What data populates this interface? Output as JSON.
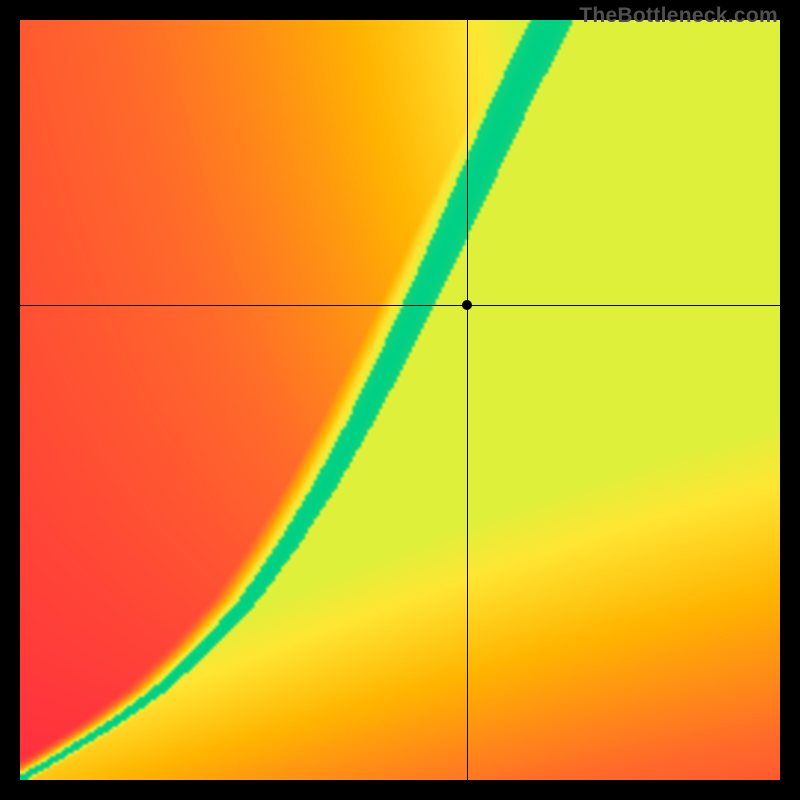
{
  "watermark": "TheBottleneck.com",
  "chart_data": {
    "type": "heatmap",
    "title": "",
    "xlabel": "",
    "ylabel": "",
    "xlim": [
      0,
      1
    ],
    "ylim": [
      0,
      1
    ],
    "grid": false,
    "legend": "none",
    "field_description": "value = closeness to ideal ridge; 1.0 on ridge (green), 0.0 far (red); asymmetric falloff with warmer plateau to the right of ridge",
    "ridge_curve_samples": [
      {
        "x": 0.0,
        "y": 0.0
      },
      {
        "x": 0.06,
        "y": 0.035
      },
      {
        "x": 0.12,
        "y": 0.072
      },
      {
        "x": 0.18,
        "y": 0.115
      },
      {
        "x": 0.24,
        "y": 0.17
      },
      {
        "x": 0.3,
        "y": 0.235
      },
      {
        "x": 0.35,
        "y": 0.305
      },
      {
        "x": 0.4,
        "y": 0.385
      },
      {
        "x": 0.45,
        "y": 0.475
      },
      {
        "x": 0.5,
        "y": 0.575
      },
      {
        "x": 0.55,
        "y": 0.68
      },
      {
        "x": 0.6,
        "y": 0.79
      },
      {
        "x": 0.65,
        "y": 0.9
      },
      {
        "x": 0.7,
        "y": 1.0
      }
    ],
    "crosshair": {
      "x": 0.588,
      "y": 0.625
    },
    "marker": {
      "x": 0.588,
      "y": 0.625
    },
    "color_stops": [
      {
        "t": 0.0,
        "hex": "#ff1f44"
      },
      {
        "t": 0.35,
        "hex": "#ff6a2a"
      },
      {
        "t": 0.6,
        "hex": "#ffb400"
      },
      {
        "t": 0.78,
        "hex": "#ffe633"
      },
      {
        "t": 0.9,
        "hex": "#d8f23d"
      },
      {
        "t": 1.0,
        "hex": "#00d084"
      }
    ],
    "resolution": 256
  }
}
